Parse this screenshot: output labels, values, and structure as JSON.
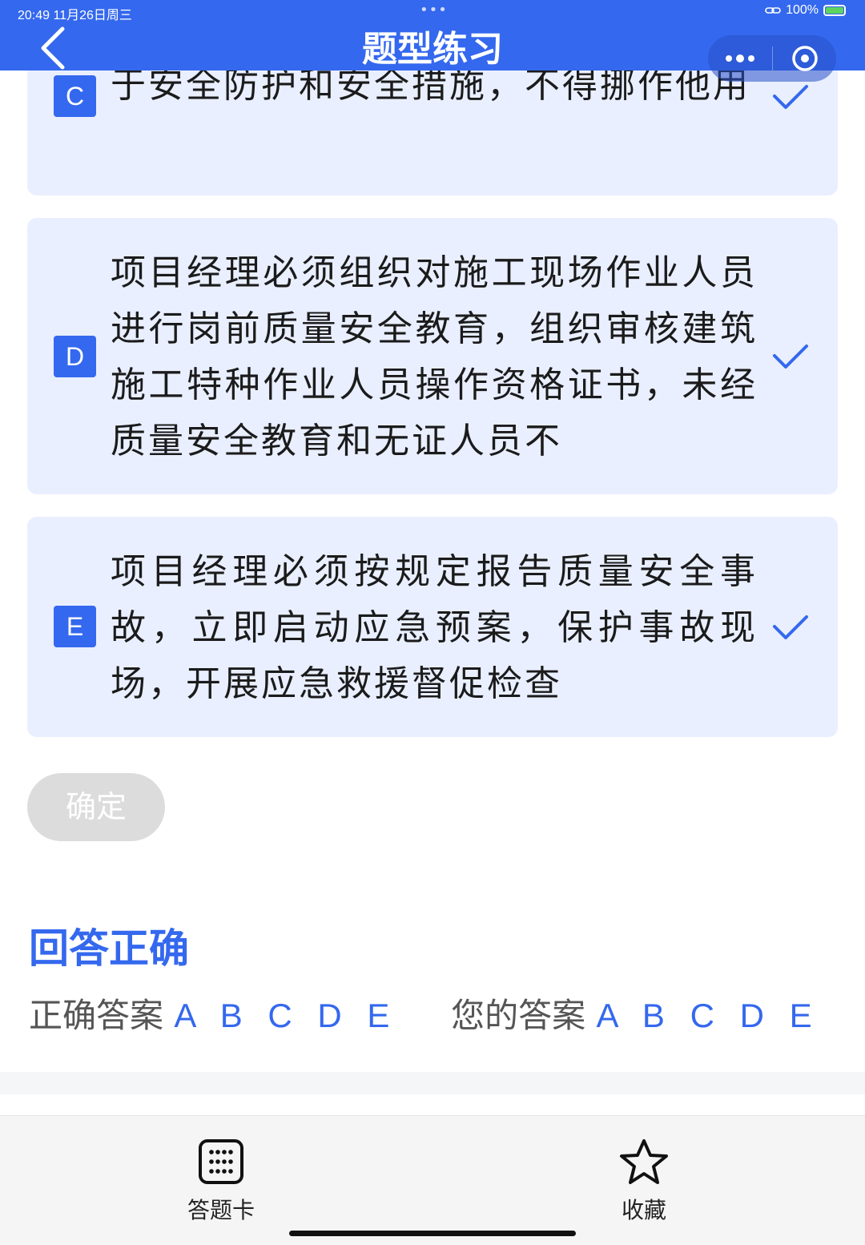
{
  "status_bar": {
    "time_date": "20:49  11月26日周三",
    "battery": "100%"
  },
  "header": {
    "title": "题型练习"
  },
  "options": [
    {
      "letter": "C",
      "text": "于安全防护和安全措施，不得挪作他用",
      "checked": true
    },
    {
      "letter": "D",
      "text": "项目经理必须组织对施工现场作业人员进行岗前质量安全教育，组织审核建筑施工特种作业人员操作资格证书，未经质量安全教育和无证人员不",
      "checked": true
    },
    {
      "letter": "E",
      "text": "项目经理必须按规定报告质量安全事故，立即启动应急预案，保护事故现场，开展应急救援督促检查",
      "checked": true
    }
  ],
  "confirm_label": "确定",
  "result": {
    "title": "回答正确",
    "correct_label": "正确答案",
    "correct_value": "ABCDE",
    "yours_label": "您的答案",
    "yours_value": "ABCDE"
  },
  "bottom_bar": {
    "answer_card_label": "答题卡",
    "favorite_label": "收藏"
  },
  "colors": {
    "accent": "#3468ee",
    "option_bg": "#e9efff",
    "button_disabled": "#dcdcdc"
  }
}
